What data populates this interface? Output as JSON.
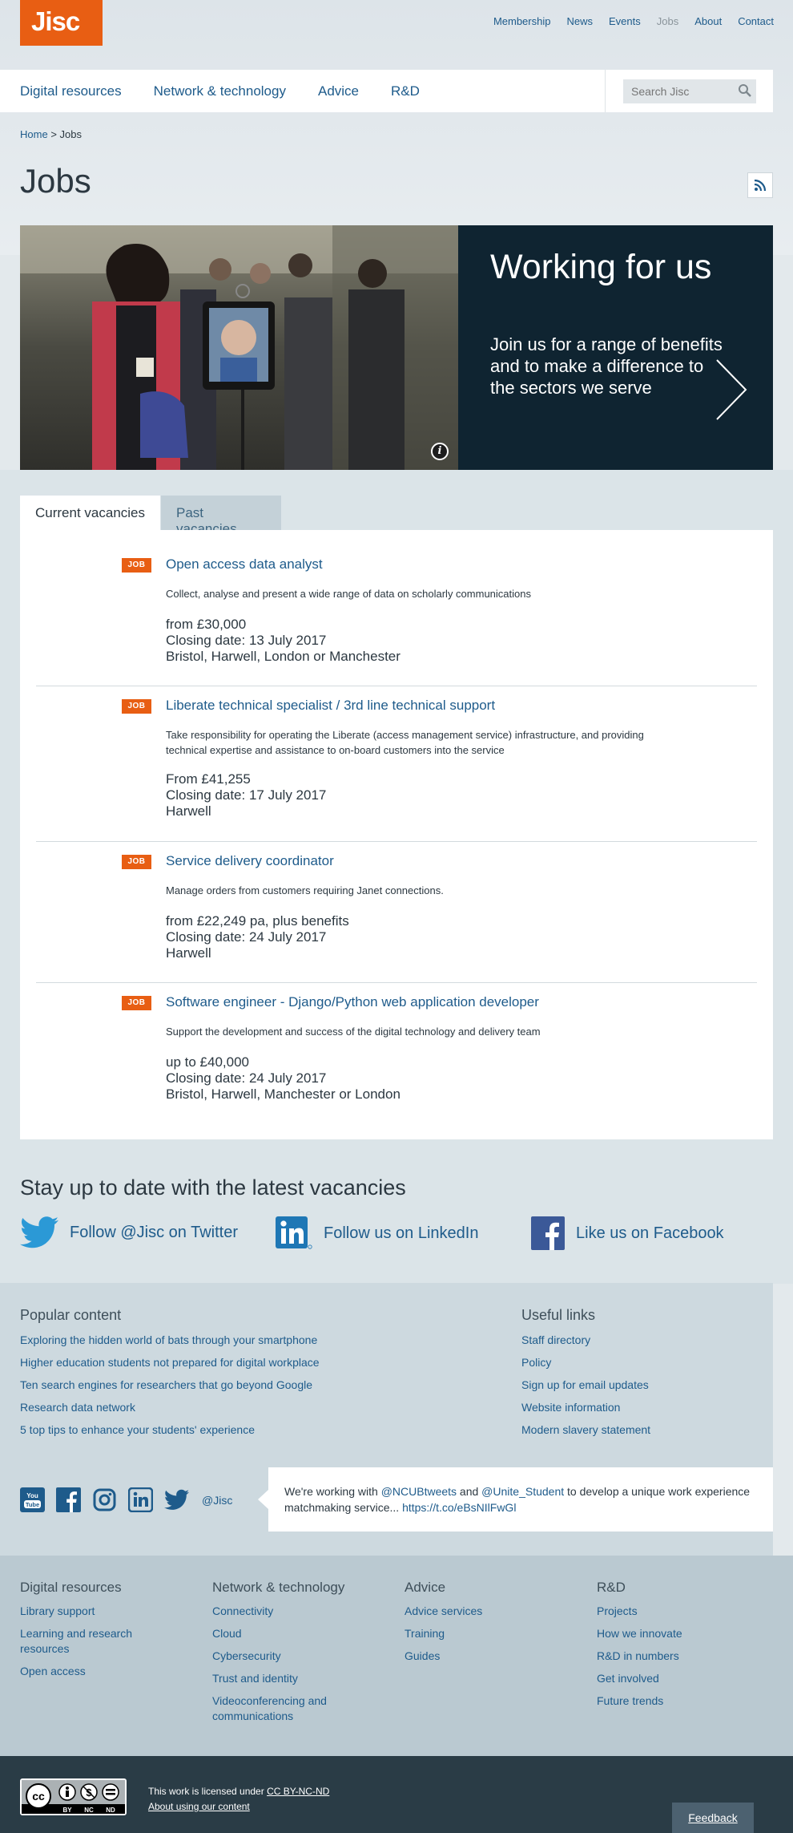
{
  "brand": {
    "logo_text": "Jisc",
    "accent": "#e85e13"
  },
  "utility_nav": [
    "Membership",
    "News",
    "Events",
    "Jobs",
    "About",
    "Contact"
  ],
  "utility_nav_active": "Jobs",
  "main_nav": [
    "Digital resources",
    "Network & technology",
    "Advice",
    "R&D"
  ],
  "search": {
    "placeholder": "Search Jisc"
  },
  "breadcrumb": {
    "home": "Home",
    "separator": ">",
    "current": "Jobs"
  },
  "page_title": "Jobs",
  "hero": {
    "title": "Working for us",
    "text": "Join us for a range of benefits and to make a difference to the sectors we serve"
  },
  "tabs": {
    "current": "Current vacancies",
    "past": "Past vacancies"
  },
  "jobs": [
    {
      "badge": "JOB",
      "title": "Open access data analyst",
      "desc": "Collect, analyse and present a wide range of data on scholarly communications",
      "salary": "from £30,000",
      "closing": "Closing date: 13 July 2017",
      "location": "Bristol, Harwell, London or Manchester"
    },
    {
      "badge": "JOB",
      "title": "Liberate technical specialist / 3rd line technical support",
      "desc": "Take responsibility for operating the Liberate (access management service) infrastructure, and providing technical expertise and assistance to on-board customers into the service",
      "salary": "From £41,255",
      "closing": "Closing date: 17 July 2017",
      "location": "Harwell"
    },
    {
      "badge": "JOB",
      "title": "Service delivery coordinator",
      "desc": "Manage orders from customers requiring Janet connections.",
      "salary": "from £22,249 pa, plus benefits",
      "closing": "Closing date: 24 July 2017",
      "location": "Harwell"
    },
    {
      "badge": "JOB",
      "title": "Software engineer - Django/Python web application developer",
      "desc": "Support the development and success of the digital technology and delivery team",
      "salary": "up to £40,000",
      "closing": "Closing date: 24 July 2017",
      "location": "Bristol, Harwell, Manchester or London"
    }
  ],
  "stay": {
    "title": "Stay up to date with the latest vacancies",
    "twitter": "Follow @Jisc on Twitter",
    "linkedin": "Follow us on LinkedIn",
    "facebook": "Like us on Facebook"
  },
  "popular": {
    "title": "Popular content",
    "links": [
      "Exploring the hidden world of bats through your smartphone",
      "Higher education students not prepared for digital workplace",
      "Ten search engines for researchers that go beyond Google",
      "Research data network",
      "5 top tips to enhance your students' experience"
    ]
  },
  "useful": {
    "title": "Useful links",
    "links": [
      "Staff directory",
      "Policy",
      "Sign up for email updates",
      "Website information",
      "Modern slavery statement"
    ]
  },
  "social": {
    "handle": "@Jisc"
  },
  "tweet": {
    "pre": "We're working with ",
    "mention1": "@NCUBtweets",
    "mid": " and ",
    "mention2": "@Unite_Student",
    "post": " to develop a unique work experience matchmaking service... ",
    "link": "https://t.co/eBsNIlFwGl"
  },
  "footer": [
    {
      "title": "Digital resources",
      "links": [
        "Library support",
        "Learning and research resources",
        "Open access"
      ]
    },
    {
      "title": "Network & technology",
      "links": [
        "Connectivity",
        "Cloud",
        "Cybersecurity",
        "Trust and identity",
        "Videoconferencing and communications"
      ]
    },
    {
      "title": "Advice",
      "links": [
        "Advice services",
        "Training",
        "Guides"
      ]
    },
    {
      "title": "R&D",
      "links": [
        "Projects",
        "How we innovate",
        "R&D in numbers",
        "Get involved",
        "Future trends"
      ]
    }
  ],
  "license": {
    "text": "This work is licensed under ",
    "link": "CC BY-NC-ND",
    "about": "About using our content"
  },
  "cc_badge": {
    "letters": "cc",
    "labels": [
      "BY",
      "NC",
      "ND"
    ]
  },
  "feedback": "Feedback"
}
